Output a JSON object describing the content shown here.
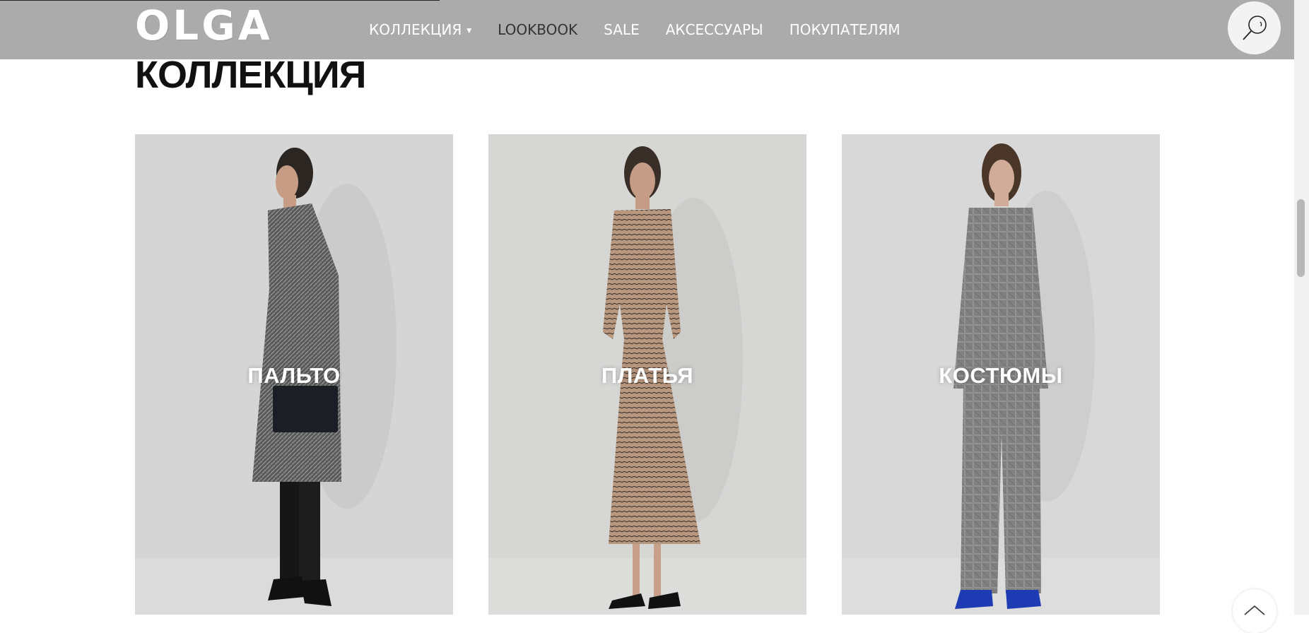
{
  "header": {
    "logo_text": "OLGA",
    "nav": [
      {
        "label": "КОЛЛЕКЦИЯ",
        "has_dropdown": true
      },
      {
        "label": "LOOKBOOK",
        "has_dropdown": false
      },
      {
        "label": "SALE",
        "has_dropdown": false
      },
      {
        "label": "АКСЕССУАРЫ",
        "has_dropdown": false
      },
      {
        "label": "ПОКУПАТЕЛЯМ",
        "has_dropdown": false
      }
    ],
    "search_icon": "search-icon"
  },
  "main": {
    "title": "КОЛЛЕКЦИЯ",
    "categories": [
      {
        "label": "ПАЛЬТО",
        "image": "model-in-tweed-coat"
      },
      {
        "label": "ПЛАТЬЯ",
        "image": "model-in-printed-dress"
      },
      {
        "label": "КОСТЮМЫ",
        "image": "model-in-checked-suit"
      }
    ]
  },
  "colors": {
    "header_bg": "#ababab",
    "card_bg": "#d5d6d5",
    "title": "#111111"
  }
}
